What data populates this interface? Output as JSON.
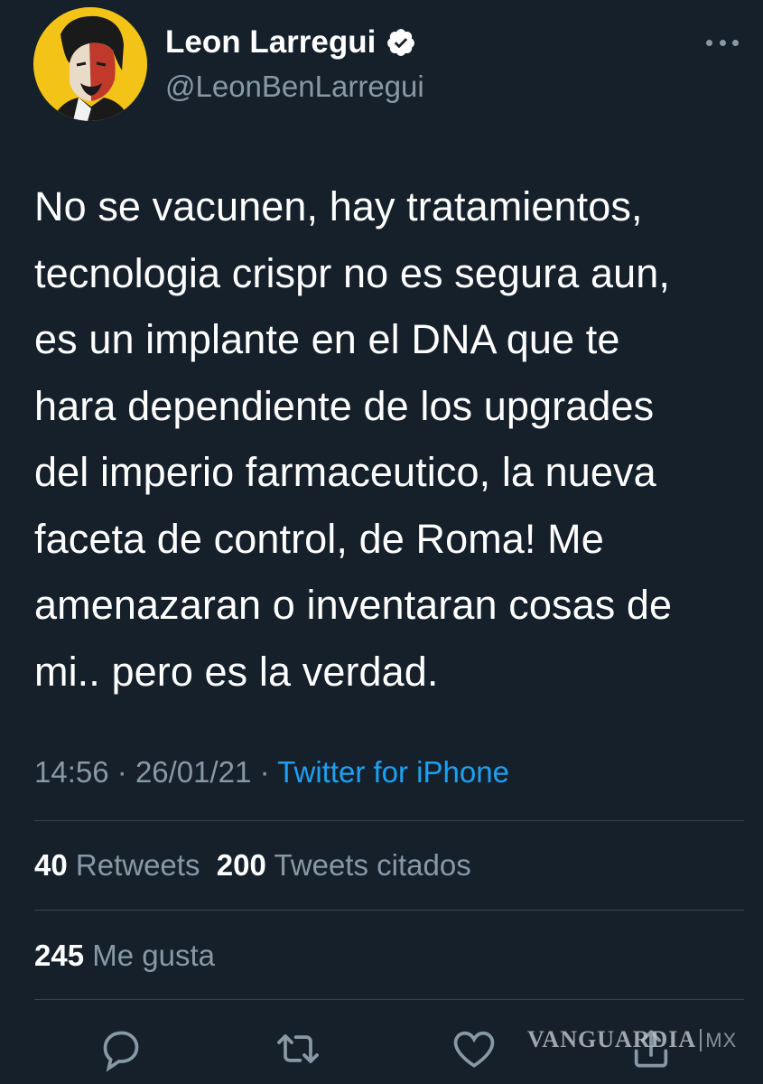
{
  "author": {
    "name": "Leon Larregui",
    "handle": "@LeonBenLarregui",
    "verified": true
  },
  "tweet": {
    "text": "No se vacunen, hay tratamientos,\ntecnologia crispr no es segura aun,\nes un implante en el DNA que te\nhara dependiente de los upgrades\ndel imperio farmaceutico, la nueva\nfaceta de control, de Roma! Me\namenazaran o inventaran cosas de\nmi.. pero es la verdad.",
    "time": "14:56",
    "date": "26/01/21",
    "separator": "·",
    "source": "Twitter for iPhone"
  },
  "stats": {
    "retweets_count": "40",
    "retweets_label": "Retweets",
    "quotes_count": "200",
    "quotes_label": "Tweets citados",
    "likes_count": "245",
    "likes_label": "Me gusta"
  },
  "actions": [
    "reply-icon",
    "retweet-icon",
    "like-icon",
    "share-icon"
  ],
  "watermark": {
    "brand": "VANGUARDIA",
    "region": "MX"
  },
  "colors": {
    "background": "#15202b",
    "text": "#ffffff",
    "secondary": "#8899a6",
    "link": "#1da1f2",
    "divider": "#38444d",
    "avatar_bg": "#f3c318"
  }
}
